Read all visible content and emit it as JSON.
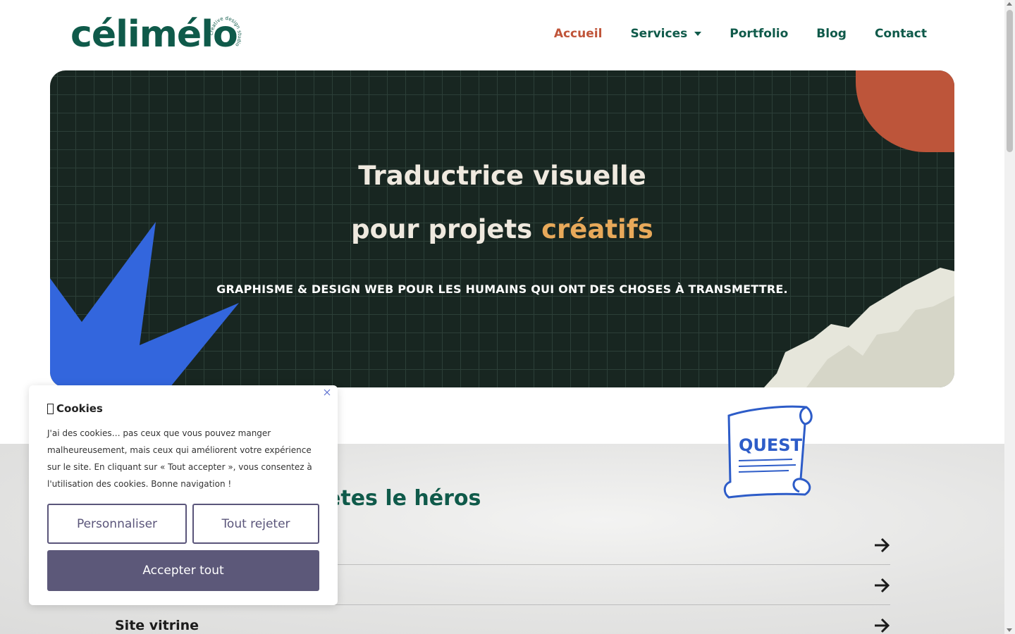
{
  "header": {
    "logo": {
      "wordmark": "célimélo",
      "ring_text": "creative design studio"
    },
    "nav": [
      {
        "label": "Accueil",
        "active": true
      },
      {
        "label": "Services",
        "has_dropdown": true
      },
      {
        "label": "Portfolio"
      },
      {
        "label": "Blog"
      },
      {
        "label": "Contact"
      }
    ]
  },
  "hero": {
    "title_line1": "Traductrice visuelle",
    "title_line2_prefix": "pour projets ",
    "title_line2_accent": "créatifs",
    "subtitle": "GRAPHISME & DESIGN WEB POUR LES HUMAINS QUI ONT DES CHOSES À TRANSMETTRE."
  },
  "services_section": {
    "heading_visible": "êtes le héros",
    "quest_label": "QUEST",
    "rows": [
      {
        "label": ""
      },
      {
        "label": ""
      },
      {
        "label": "Site vitrine"
      }
    ]
  },
  "cookie_banner": {
    "title": "Cookies",
    "text": "J'ai des cookies… pas ceux que vous pouvez manger malheureusement, mais ceux qui améliorent votre expérience sur le site. En cliquant sur « Tout accepter », vous consentez à l'utilisation des cookies. Bonne navigation !",
    "customize_label": "Personnaliser",
    "reject_label": "Tout rejeter",
    "accept_label": "Accepter tout"
  },
  "colors": {
    "brand_green": "#0f5a4a",
    "active_orange": "#c0553a",
    "hero_bg": "#182621",
    "accent_gold": "#e8a95a",
    "button_purple": "#5c5879"
  }
}
